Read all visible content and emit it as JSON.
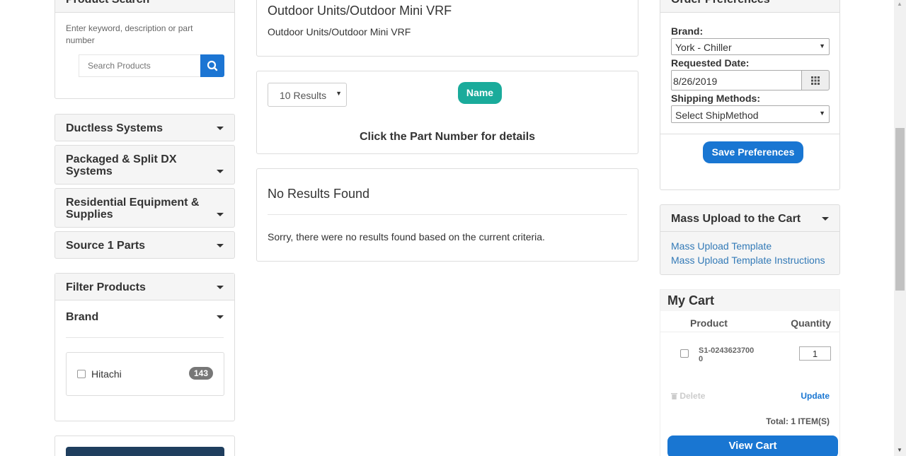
{
  "product_search": {
    "title": "Product Search",
    "help_text": "Enter keyword, description or part number",
    "placeholder": "Search Products"
  },
  "categories": [
    {
      "label": "Ductless Systems"
    },
    {
      "label": "Packaged & Split DX Systems"
    },
    {
      "label": "Residential Equipment & Supplies"
    },
    {
      "label": "Source 1 Parts"
    }
  ],
  "filter": {
    "title": "Filter Products",
    "brand_title": "Brand",
    "brands": [
      {
        "label": "Hitachi",
        "count": "143"
      }
    ]
  },
  "category_header": {
    "title": "Outdoor Units/Outdoor Mini VRF",
    "subtitle": "Outdoor Units/Outdoor Mini VRF"
  },
  "results_bar": {
    "page_size": "10 Results",
    "sort_label": "Name",
    "hint": "Click the Part Number for details"
  },
  "no_results": {
    "title": "No Results Found",
    "message": "Sorry, there were no results found based on the current criteria."
  },
  "order_prefs": {
    "title": "Order Preferences",
    "collapse_glyph": "−",
    "brand_label": "Brand:",
    "brand_value": "York - Chiller",
    "date_label": "Requested Date:",
    "date_value": "8/26/2019",
    "shipping_label": "Shipping Methods:",
    "shipping_value": "Select ShipMethod",
    "save_label": "Save Preferences"
  },
  "mass_upload": {
    "title": "Mass Upload to the Cart",
    "links": [
      "Mass Upload Template",
      "Mass Upload Template Instructions"
    ]
  },
  "cart": {
    "title": "My Cart",
    "col_product": "Product",
    "col_quantity": "Quantity",
    "items": [
      {
        "product": "S1-02436237000",
        "quantity": "1"
      }
    ],
    "delete_label": "Delete",
    "update_label": "Update",
    "total": "Total: 1 ITEM(S)",
    "view_cart_label": "View Cart"
  },
  "colors": {
    "accent_blue": "#1976d2",
    "sort_teal": "#1aab9b",
    "badge_grey": "#777777"
  }
}
